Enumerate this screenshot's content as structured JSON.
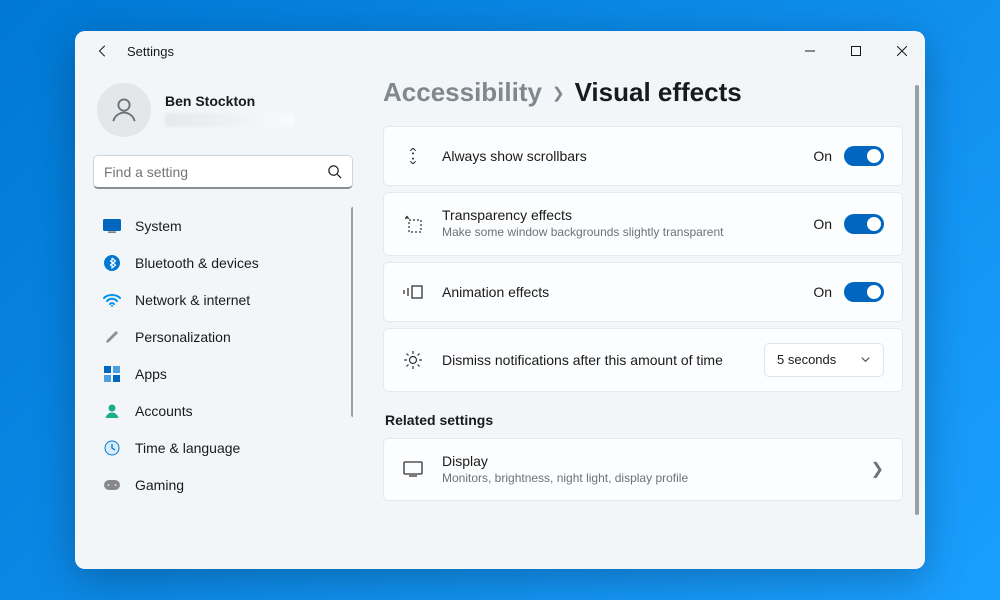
{
  "window": {
    "title": "Settings"
  },
  "profile": {
    "name": "Ben Stockton"
  },
  "search": {
    "placeholder": "Find a setting"
  },
  "nav": [
    {
      "label": "System"
    },
    {
      "label": "Bluetooth & devices"
    },
    {
      "label": "Network & internet"
    },
    {
      "label": "Personalization"
    },
    {
      "label": "Apps"
    },
    {
      "label": "Accounts"
    },
    {
      "label": "Time & language"
    },
    {
      "label": "Gaming"
    }
  ],
  "breadcrumb": {
    "parent": "Accessibility",
    "current": "Visual effects"
  },
  "settings": {
    "scrollbars": {
      "title": "Always show scrollbars",
      "state": "On"
    },
    "transparency": {
      "title": "Transparency effects",
      "sub": "Make some window backgrounds slightly transparent",
      "state": "On"
    },
    "animation": {
      "title": "Animation effects",
      "state": "On"
    },
    "dismiss": {
      "title": "Dismiss notifications after this amount of time",
      "value": "5 seconds"
    }
  },
  "related": {
    "heading": "Related settings",
    "display": {
      "title": "Display",
      "sub": "Monitors, brightness, night light, display profile"
    }
  }
}
